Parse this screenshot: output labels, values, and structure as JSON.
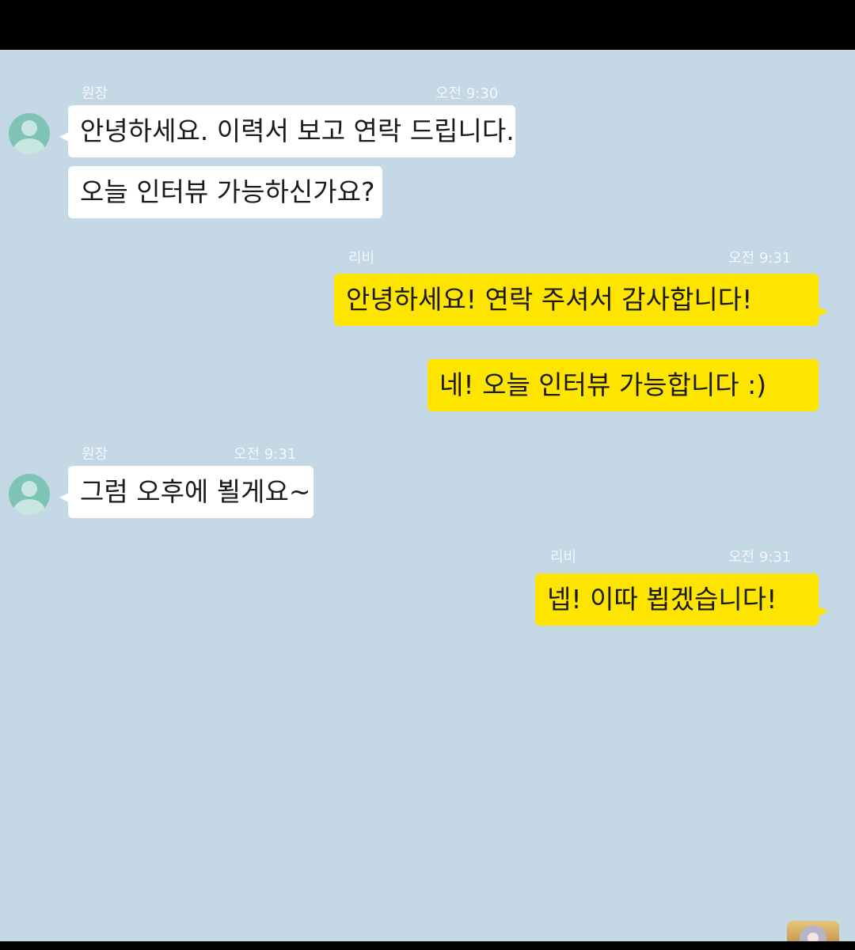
{
  "colors": {
    "chat_background": "#c5d8e6",
    "incoming_bubble": "#ffffff",
    "outgoing_bubble": "#fee500",
    "avatar": "#7fc2b6"
  },
  "messages": [
    {
      "group": 1,
      "sender": "원장",
      "time": "오전 9:30",
      "direction": "incoming",
      "texts": [
        "안녕하세요. 이력서 보고 연락 드립니다.",
        "오늘 인터뷰 가능하신가요?"
      ]
    },
    {
      "group": 2,
      "sender": "리비",
      "time": "오전 9:31",
      "direction": "outgoing",
      "texts": [
        "안녕하세요! 연락 주셔서 감사합니다!",
        "네! 오늘 인터뷰 가능합니다 :)"
      ]
    },
    {
      "group": 3,
      "sender": "원장",
      "time": "오전 9:31",
      "direction": "incoming",
      "texts": [
        "그럼 오후에 뵐게요~"
      ]
    },
    {
      "group": 4,
      "sender": "리비",
      "time": "오전 9:31",
      "direction": "outgoing",
      "texts": [
        "넵! 이따 뵙겠습니다!"
      ]
    }
  ],
  "thumbnail": {
    "icon": "channel-avatar-icon"
  }
}
